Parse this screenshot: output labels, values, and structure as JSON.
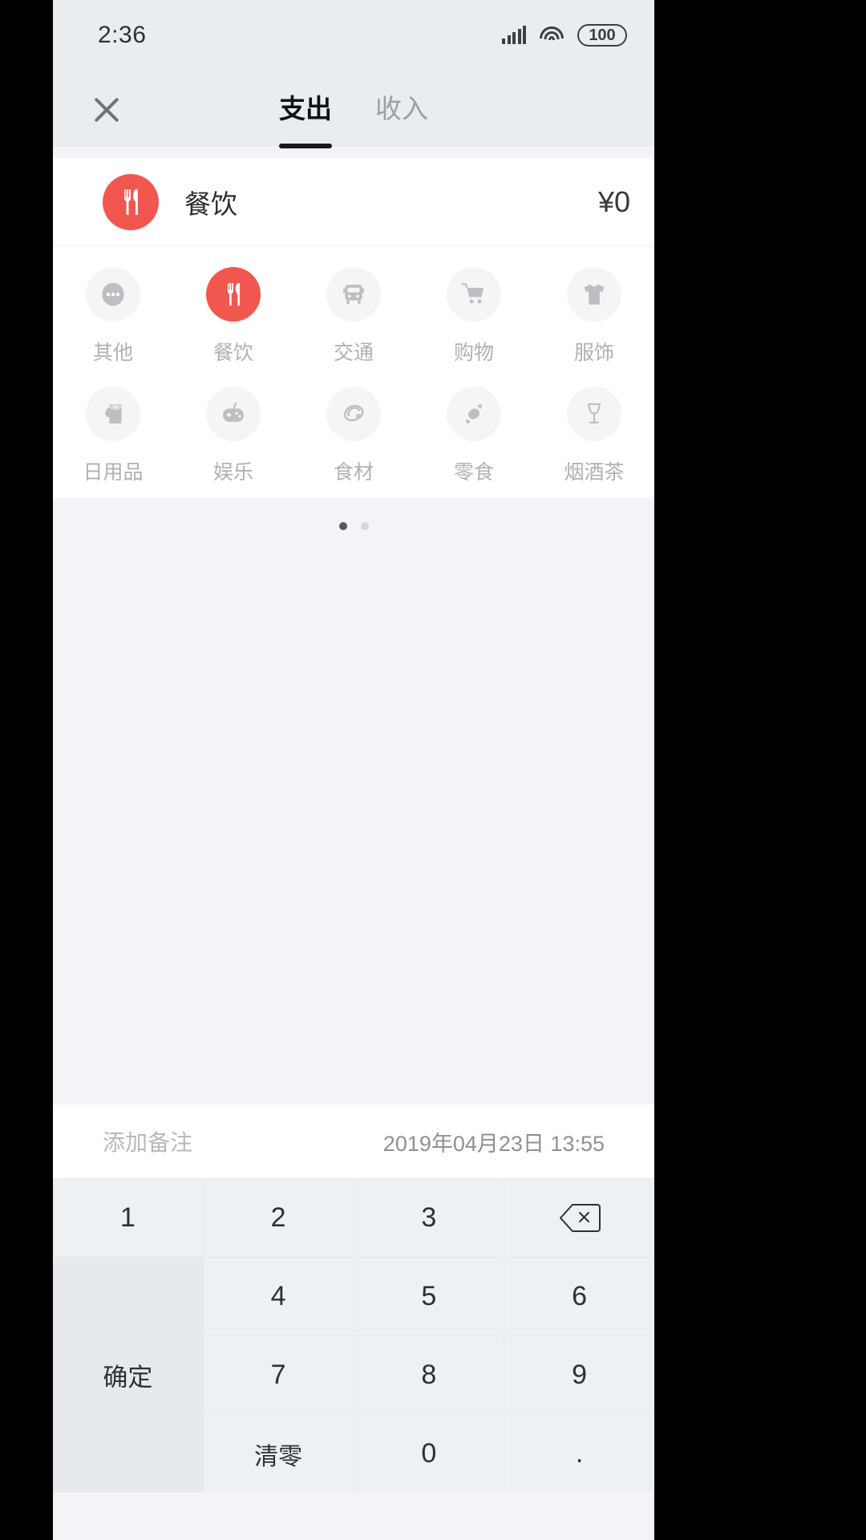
{
  "theme": {
    "accent": "#f1574f",
    "status_bg": "#e9edf0",
    "page_bg": "#f4f4f8",
    "key_bg": "#eef1f4"
  },
  "statusbar": {
    "time": "2:36",
    "signal_icon": "signal-bars-icon",
    "wifi_icon": "wifi-icon",
    "battery_icon": "battery-icon",
    "battery_level": "100"
  },
  "header": {
    "close_icon": "close-icon",
    "tabs": [
      {
        "label": "支出",
        "active": true
      },
      {
        "label": "收入",
        "active": false
      }
    ]
  },
  "selected": {
    "icon": "restaurant-icon",
    "name": "餐饮",
    "amount": "¥0"
  },
  "categories": [
    {
      "label": "其他",
      "icon": "ellipsis-icon",
      "selected": false
    },
    {
      "label": "餐饮",
      "icon": "restaurant-icon",
      "selected": true
    },
    {
      "label": "交通",
      "icon": "bus-icon",
      "selected": false
    },
    {
      "label": "购物",
      "icon": "cart-icon",
      "selected": false
    },
    {
      "label": "服饰",
      "icon": "tshirt-icon",
      "selected": false
    },
    {
      "label": "日用品",
      "icon": "paper-roll-icon",
      "selected": false
    },
    {
      "label": "娱乐",
      "icon": "gamepad-icon",
      "selected": false
    },
    {
      "label": "食材",
      "icon": "meat-icon",
      "selected": false
    },
    {
      "label": "零食",
      "icon": "candy-icon",
      "selected": false
    },
    {
      "label": "烟酒茶",
      "icon": "wine-glass-icon",
      "selected": false
    }
  ],
  "pager": {
    "pages": 2,
    "active": 0
  },
  "note": {
    "placeholder": "添加备注",
    "datetime": "2019年04月23日 13:55"
  },
  "keypad": {
    "keys": [
      "1",
      "2",
      "3",
      "4",
      "5",
      "6",
      "7",
      "8",
      "9",
      "0"
    ],
    "clear_label": "清零",
    "dot_label": ".",
    "backspace_icon": "backspace-icon",
    "confirm_label": "确定"
  }
}
